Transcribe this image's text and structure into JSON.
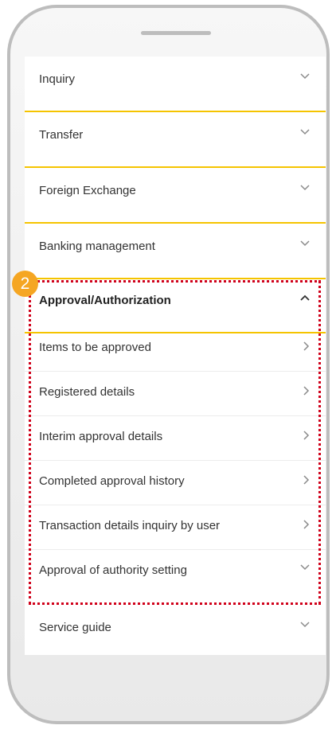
{
  "menu": {
    "items": [
      {
        "label": "Inquiry"
      },
      {
        "label": "Transfer"
      },
      {
        "label": "Foreign Exchange"
      },
      {
        "label": "Banking management"
      }
    ],
    "expanded": {
      "label": "Approval/Authorization",
      "subitems": [
        {
          "label": "Items to be approved"
        },
        {
          "label": "Registered details"
        },
        {
          "label": "Interim approval details"
        },
        {
          "label": "Completed approval history"
        },
        {
          "label": "Transaction details inquiry by user"
        },
        {
          "label": "Approval of authority setting"
        }
      ]
    },
    "footer_item": {
      "label": "Service guide"
    }
  },
  "annotation": {
    "badge": "2",
    "highlight_color": "#d0021b",
    "badge_color": "#f5a623"
  },
  "colors": {
    "accent": "#f5c400"
  },
  "icons": {
    "collapsed": "chevron-down-icon",
    "expanded": "chevron-up-icon",
    "submenu": "chevron-right-icon"
  }
}
